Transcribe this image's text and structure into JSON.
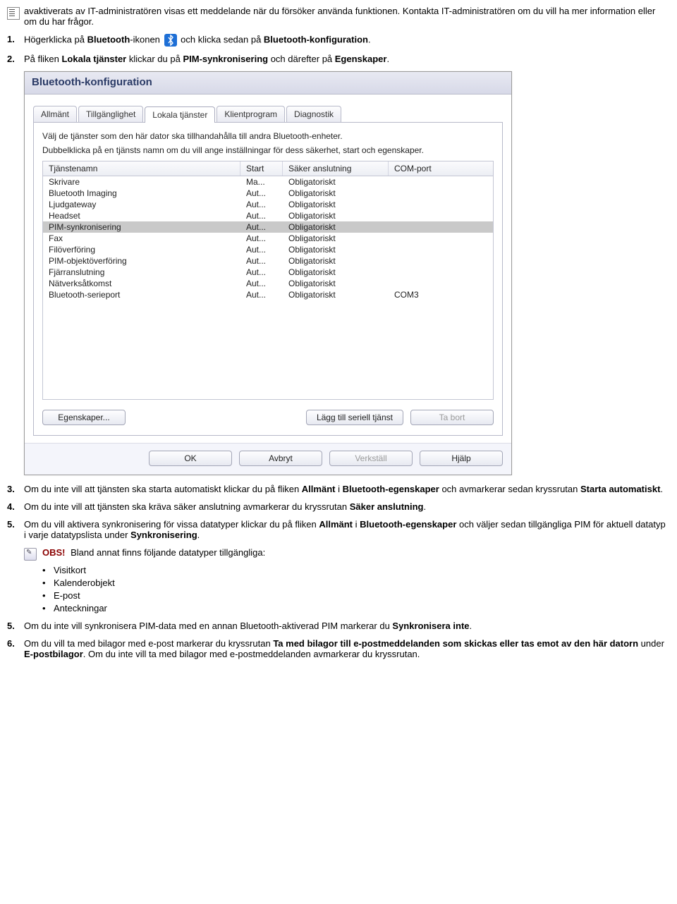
{
  "intro_text": "avaktiverats av IT-administratören visas ett meddelande när du försöker använda funktionen. Kontakta IT-administratören om du vill ha mer information eller om du har frågor.",
  "steps": {
    "s1_num": "1.",
    "s1_a": "Högerklicka på ",
    "s1_b": "Bluetooth",
    "s1_c": "-ikonen ",
    "s1_d": " och klicka sedan på ",
    "s1_e": "Bluetooth-konfiguration",
    "s1_f": ".",
    "s2_num": "2.",
    "s2_a": "På fliken ",
    "s2_b": "Lokala tjänster",
    "s2_c": " klickar du på ",
    "s2_d": "PIM-synkronisering",
    "s2_e": " och därefter på ",
    "s2_f": "Egenskaper",
    "s2_g": ".",
    "s3_num": "3.",
    "s3_a": "Om du inte vill att tjänsten ska starta automatiskt klickar du på fliken ",
    "s3_b": "Allmänt",
    "s3_c": " i ",
    "s3_d": "Bluetooth-egenskaper",
    "s3_e": " och avmarkerar sedan kryssrutan ",
    "s3_f": "Starta automatiskt",
    "s3_g": ".",
    "s4_num": "4.",
    "s4_a": "Om du inte vill att tjänsten ska kräva säker anslutning avmarkerar du kryssrutan ",
    "s4_b": "Säker anslutning",
    "s4_c": ".",
    "s5a_num": "5.",
    "s5a_a": "Om du vill aktivera synkronisering för vissa datatyper klickar du på fliken ",
    "s5a_b": "Allmänt",
    "s5a_c": " i ",
    "s5a_d": "Bluetooth-egenskaper",
    "s5a_e": " och väljer sedan tillgängliga PIM för aktuell datatyp i varje datatypslista under ",
    "s5a_f": "Synkronisering",
    "s5a_g": ".",
    "s5b_num": "5.",
    "s5b_a": "Om du inte vill synkronisera PIM-data med en annan Bluetooth-aktiverad PIM markerar du ",
    "s5b_b": "Synkronisera inte",
    "s5b_c": ".",
    "s6_num": "6.",
    "s6_a": "Om du vill ta med bilagor med e-post markerar du kryssrutan ",
    "s6_b": "Ta med bilagor till e-postmeddelanden som skickas eller tas emot av den här datorn",
    "s6_c": " under ",
    "s6_d": "E-postbilagor",
    "s6_e": ". Om du inte vill ta med bilagor med e-postmeddelanden avmarkerar du kryssrutan."
  },
  "obs": {
    "label": "OBS!",
    "text": " Bland annat finns följande datatyper tillgängliga:",
    "items": [
      "Visitkort",
      "Kalenderobjekt",
      "E-post",
      "Anteckningar"
    ]
  },
  "dialog": {
    "title": "Bluetooth-konfiguration",
    "tabs": [
      "Allmänt",
      "Tillgänglighet",
      "Lokala tjänster",
      "Klientprogram",
      "Diagnostik"
    ],
    "active_tab_index": 2,
    "desc1": "Välj de tjänster som den här dator ska tillhandahålla till andra Bluetooth-enheter.",
    "desc2": "Dubbelklicka på en tjänsts namn om du vill ange inställningar för dess säkerhet, start och egenskaper.",
    "columns": [
      "Tjänstenamn",
      "Start",
      "Säker anslutning",
      "COM-port"
    ],
    "rows": [
      {
        "name": "Skrivare",
        "start": "Ma...",
        "secure": "Obligatoriskt",
        "com": ""
      },
      {
        "name": "Bluetooth Imaging",
        "start": "Aut...",
        "secure": "Obligatoriskt",
        "com": ""
      },
      {
        "name": "Ljudgateway",
        "start": "Aut...",
        "secure": "Obligatoriskt",
        "com": ""
      },
      {
        "name": "Headset",
        "start": "Aut...",
        "secure": "Obligatoriskt",
        "com": ""
      },
      {
        "name": "PIM-synkronisering",
        "start": "Aut...",
        "secure": "Obligatoriskt",
        "com": ""
      },
      {
        "name": "Fax",
        "start": "Aut...",
        "secure": "Obligatoriskt",
        "com": ""
      },
      {
        "name": "Filöverföring",
        "start": "Aut...",
        "secure": "Obligatoriskt",
        "com": ""
      },
      {
        "name": "PIM-objektöverföring",
        "start": "Aut...",
        "secure": "Obligatoriskt",
        "com": ""
      },
      {
        "name": "Fjärranslutning",
        "start": "Aut...",
        "secure": "Obligatoriskt",
        "com": ""
      },
      {
        "name": "Nätverksåtkomst",
        "start": "Aut...",
        "secure": "Obligatoriskt",
        "com": ""
      },
      {
        "name": "Bluetooth-serieport",
        "start": "Aut...",
        "secure": "Obligatoriskt",
        "com": "COM3"
      }
    ],
    "selected_row_index": 4,
    "buttons": {
      "properties": "Egenskaper...",
      "add_serial": "Lägg till seriell tjänst",
      "remove": "Ta bort",
      "ok": "OK",
      "cancel": "Avbryt",
      "apply": "Verkställ",
      "help": "Hjälp"
    }
  }
}
